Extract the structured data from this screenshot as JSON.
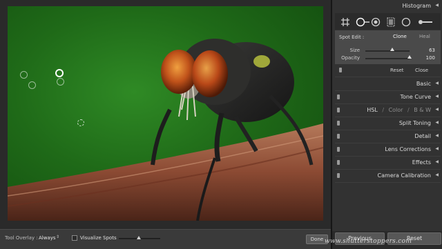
{
  "panel": {
    "histogram": {
      "label": "Histogram"
    },
    "spot_edit": {
      "title": "Spot Edit :",
      "clone_label": "Clone",
      "heal_label": "Heal",
      "size_label": "Size",
      "size_value": "63",
      "size_fraction": 0.63,
      "opacity_label": "Opacity",
      "opacity_value": "100",
      "opacity_fraction": 1.0,
      "reset_label": "Reset",
      "close_label": "Close"
    },
    "sections": {
      "basic": "Basic",
      "tone_curve": "Tone Curve",
      "hsl": "HSL",
      "color": "Color",
      "bw": "B & W",
      "split_toning": "Split Toning",
      "detail": "Detail",
      "lens_corrections": "Lens Corrections",
      "effects": "Effects",
      "camera_calibration": "Camera Calibration"
    },
    "hsl_separator": "/",
    "previous_button": "Previous",
    "reset_button": "Reset"
  },
  "toolbar": {
    "tool_overlay_label": "Tool Overlay :",
    "tool_overlay_value": "Always",
    "visualize_spots_label": "Visualize Spots",
    "done_label": "Done"
  },
  "watermark": "www.shutterstoppers.com",
  "colors": {
    "photo_background": "#2f8a25",
    "panel_background": "#323232",
    "spot_edit_background": "#4a4a4a"
  }
}
